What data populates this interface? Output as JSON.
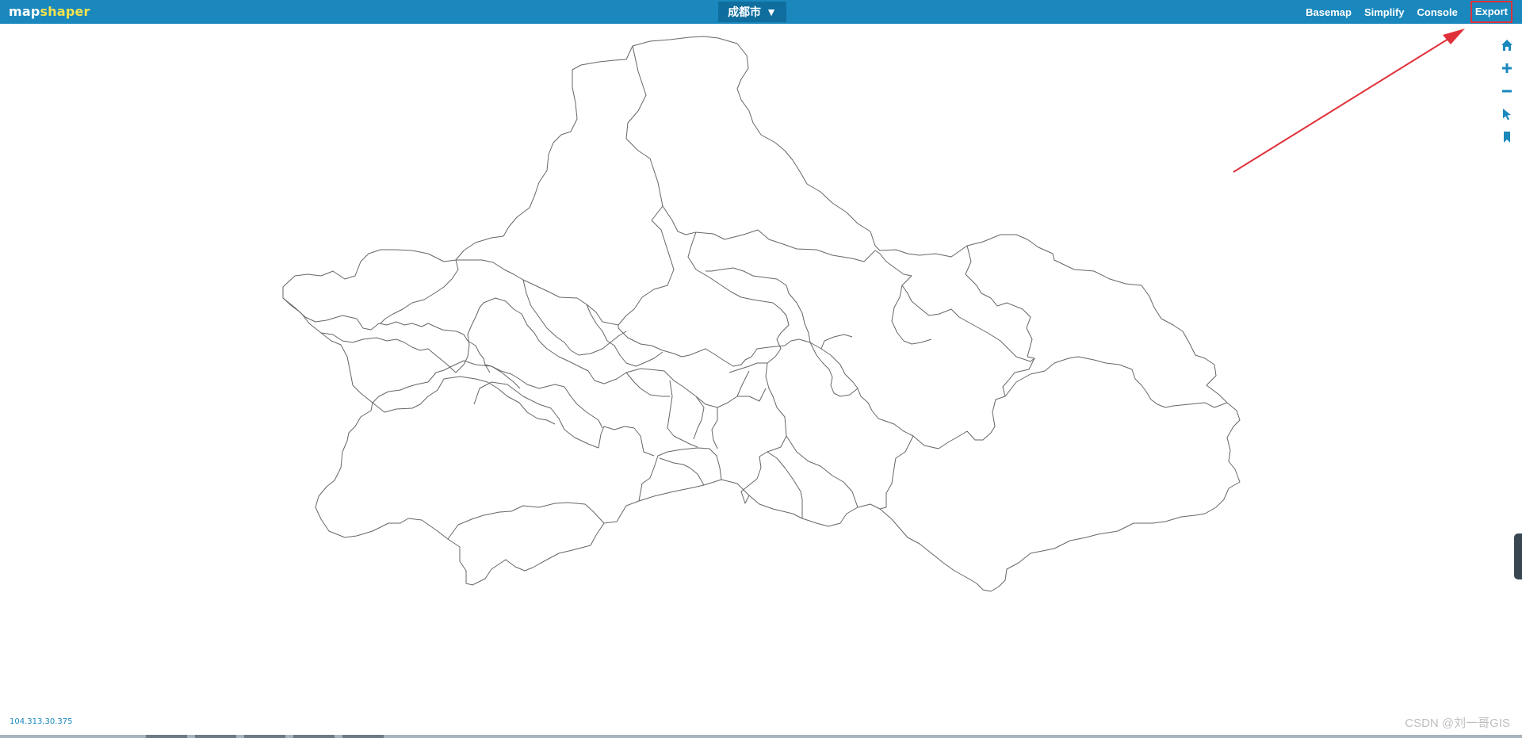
{
  "app": {
    "logo_prefix": "map",
    "logo_suffix": "shaper",
    "layer_name": "成都市",
    "layer_caret": "▼"
  },
  "menu": {
    "basemap": "Basemap",
    "simplify": "Simplify",
    "console": "Console",
    "export": "Export"
  },
  "tools": [
    "home-icon",
    "zoom-in-icon",
    "zoom-out-icon",
    "pointer-icon",
    "bookmark-icon"
  ],
  "status": {
    "coordinates": "104.313,30.375"
  },
  "watermark": "CSDN @刘一哥GIS",
  "colors": {
    "topbar": "#1a88bd",
    "boundary": "#666666",
    "annotation": "#e0313a"
  }
}
